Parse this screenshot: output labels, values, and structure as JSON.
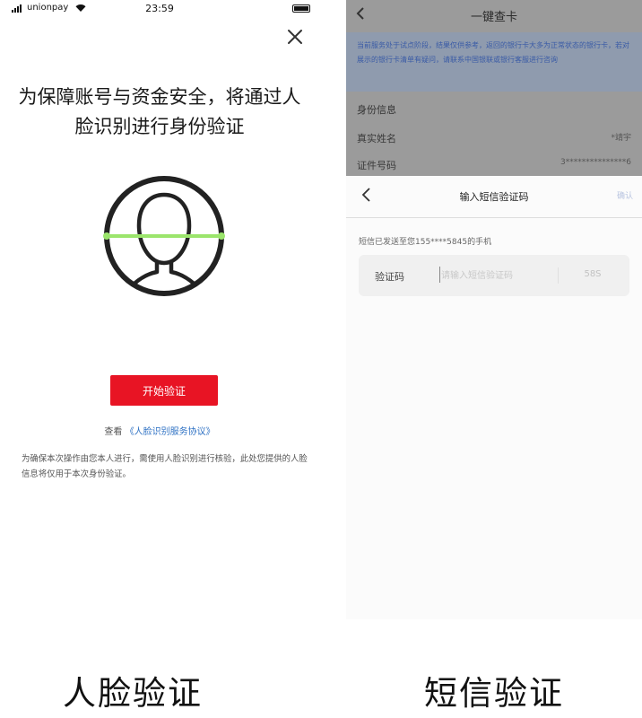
{
  "left_phone": {
    "status_bar": {
      "carrier": "unionpay",
      "time": "23:59"
    },
    "title": "为保障账号与资金安全，将通过人脸识别进行身份验证",
    "start_button": "开始验证",
    "agreement_prefix": "查看",
    "agreement_link": "《人脸识别服务协议》",
    "notice": "为确保本次操作由您本人进行，需使用人脸识别进行核验，此处您提供的人脸信息将仅用于本次身份验证。",
    "accent_color": "#e81424"
  },
  "right_phone": {
    "page_title": "一键查卡",
    "banner": "当前服务处于试点阶段，结果仅供参考，返回的银行卡大多为正常状态的银行卡，若对展示的银行卡清单有疑问，请联系中国银联或银行客服进行咨询",
    "section_label": "身份信息",
    "fields": [
      {
        "label": "真实姓名",
        "value": "*靖宇"
      },
      {
        "label": "证件号码",
        "value": "3***************6"
      }
    ],
    "sheet": {
      "title": "输入短信验证码",
      "confirm": "确认",
      "sent_text": "短信已发送至您155****5845的手机",
      "code_label": "验证码",
      "code_placeholder": "请输入短信验证码",
      "countdown": "58S"
    }
  },
  "captions": {
    "left": "人脸验证",
    "right": "短信验证"
  }
}
